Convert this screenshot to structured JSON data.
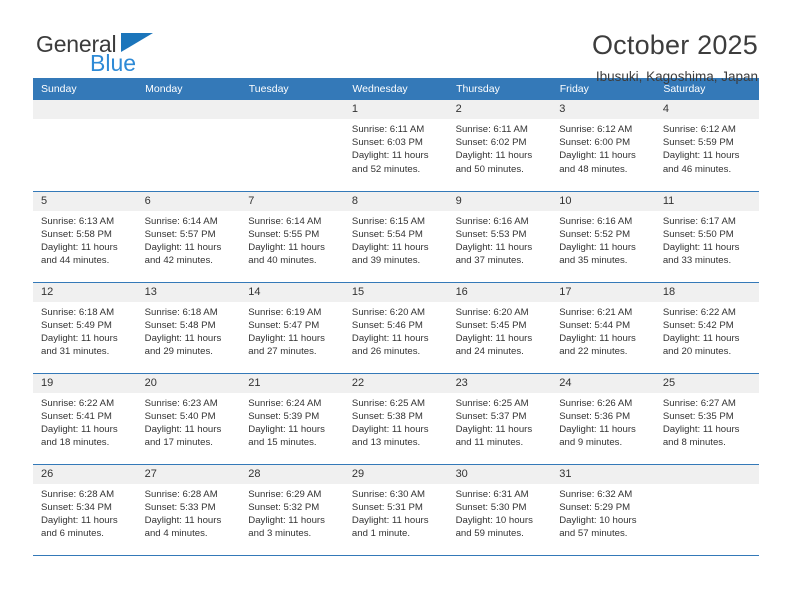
{
  "brand": {
    "name_top": "General",
    "name_bottom": "Blue",
    "triangle_color": "#1b75bb",
    "blue_text_color": "#2e8ad6"
  },
  "header": {
    "title": "October 2025",
    "subtitle": "Ibusuki, Kagoshima, Japan"
  },
  "colors": {
    "header_blue": "#3479b8",
    "daynum_band": "#f0f0f0",
    "text": "#333333"
  },
  "calendar": {
    "weekday_headers": [
      "Sunday",
      "Monday",
      "Tuesday",
      "Wednesday",
      "Thursday",
      "Friday",
      "Saturday"
    ],
    "weeks": [
      [
        {
          "day": "",
          "empty": true,
          "sunrise": "",
          "sunset": "",
          "daylight_line1": "",
          "daylight_line2": ""
        },
        {
          "day": "",
          "empty": true,
          "sunrise": "",
          "sunset": "",
          "daylight_line1": "",
          "daylight_line2": ""
        },
        {
          "day": "",
          "empty": true,
          "sunrise": "",
          "sunset": "",
          "daylight_line1": "",
          "daylight_line2": ""
        },
        {
          "day": "1",
          "empty": false,
          "sunrise": "Sunrise: 6:11 AM",
          "sunset": "Sunset: 6:03 PM",
          "daylight_line1": "Daylight: 11 hours",
          "daylight_line2": "and 52 minutes."
        },
        {
          "day": "2",
          "empty": false,
          "sunrise": "Sunrise: 6:11 AM",
          "sunset": "Sunset: 6:02 PM",
          "daylight_line1": "Daylight: 11 hours",
          "daylight_line2": "and 50 minutes."
        },
        {
          "day": "3",
          "empty": false,
          "sunrise": "Sunrise: 6:12 AM",
          "sunset": "Sunset: 6:00 PM",
          "daylight_line1": "Daylight: 11 hours",
          "daylight_line2": "and 48 minutes."
        },
        {
          "day": "4",
          "empty": false,
          "sunrise": "Sunrise: 6:12 AM",
          "sunset": "Sunset: 5:59 PM",
          "daylight_line1": "Daylight: 11 hours",
          "daylight_line2": "and 46 minutes."
        }
      ],
      [
        {
          "day": "5",
          "empty": false,
          "sunrise": "Sunrise: 6:13 AM",
          "sunset": "Sunset: 5:58 PM",
          "daylight_line1": "Daylight: 11 hours",
          "daylight_line2": "and 44 minutes."
        },
        {
          "day": "6",
          "empty": false,
          "sunrise": "Sunrise: 6:14 AM",
          "sunset": "Sunset: 5:57 PM",
          "daylight_line1": "Daylight: 11 hours",
          "daylight_line2": "and 42 minutes."
        },
        {
          "day": "7",
          "empty": false,
          "sunrise": "Sunrise: 6:14 AM",
          "sunset": "Sunset: 5:55 PM",
          "daylight_line1": "Daylight: 11 hours",
          "daylight_line2": "and 40 minutes."
        },
        {
          "day": "8",
          "empty": false,
          "sunrise": "Sunrise: 6:15 AM",
          "sunset": "Sunset: 5:54 PM",
          "daylight_line1": "Daylight: 11 hours",
          "daylight_line2": "and 39 minutes."
        },
        {
          "day": "9",
          "empty": false,
          "sunrise": "Sunrise: 6:16 AM",
          "sunset": "Sunset: 5:53 PM",
          "daylight_line1": "Daylight: 11 hours",
          "daylight_line2": "and 37 minutes."
        },
        {
          "day": "10",
          "empty": false,
          "sunrise": "Sunrise: 6:16 AM",
          "sunset": "Sunset: 5:52 PM",
          "daylight_line1": "Daylight: 11 hours",
          "daylight_line2": "and 35 minutes."
        },
        {
          "day": "11",
          "empty": false,
          "sunrise": "Sunrise: 6:17 AM",
          "sunset": "Sunset: 5:50 PM",
          "daylight_line1": "Daylight: 11 hours",
          "daylight_line2": "and 33 minutes."
        }
      ],
      [
        {
          "day": "12",
          "empty": false,
          "sunrise": "Sunrise: 6:18 AM",
          "sunset": "Sunset: 5:49 PM",
          "daylight_line1": "Daylight: 11 hours",
          "daylight_line2": "and 31 minutes."
        },
        {
          "day": "13",
          "empty": false,
          "sunrise": "Sunrise: 6:18 AM",
          "sunset": "Sunset: 5:48 PM",
          "daylight_line1": "Daylight: 11 hours",
          "daylight_line2": "and 29 minutes."
        },
        {
          "day": "14",
          "empty": false,
          "sunrise": "Sunrise: 6:19 AM",
          "sunset": "Sunset: 5:47 PM",
          "daylight_line1": "Daylight: 11 hours",
          "daylight_line2": "and 27 minutes."
        },
        {
          "day": "15",
          "empty": false,
          "sunrise": "Sunrise: 6:20 AM",
          "sunset": "Sunset: 5:46 PM",
          "daylight_line1": "Daylight: 11 hours",
          "daylight_line2": "and 26 minutes."
        },
        {
          "day": "16",
          "empty": false,
          "sunrise": "Sunrise: 6:20 AM",
          "sunset": "Sunset: 5:45 PM",
          "daylight_line1": "Daylight: 11 hours",
          "daylight_line2": "and 24 minutes."
        },
        {
          "day": "17",
          "empty": false,
          "sunrise": "Sunrise: 6:21 AM",
          "sunset": "Sunset: 5:44 PM",
          "daylight_line1": "Daylight: 11 hours",
          "daylight_line2": "and 22 minutes."
        },
        {
          "day": "18",
          "empty": false,
          "sunrise": "Sunrise: 6:22 AM",
          "sunset": "Sunset: 5:42 PM",
          "daylight_line1": "Daylight: 11 hours",
          "daylight_line2": "and 20 minutes."
        }
      ],
      [
        {
          "day": "19",
          "empty": false,
          "sunrise": "Sunrise: 6:22 AM",
          "sunset": "Sunset: 5:41 PM",
          "daylight_line1": "Daylight: 11 hours",
          "daylight_line2": "and 18 minutes."
        },
        {
          "day": "20",
          "empty": false,
          "sunrise": "Sunrise: 6:23 AM",
          "sunset": "Sunset: 5:40 PM",
          "daylight_line1": "Daylight: 11 hours",
          "daylight_line2": "and 17 minutes."
        },
        {
          "day": "21",
          "empty": false,
          "sunrise": "Sunrise: 6:24 AM",
          "sunset": "Sunset: 5:39 PM",
          "daylight_line1": "Daylight: 11 hours",
          "daylight_line2": "and 15 minutes."
        },
        {
          "day": "22",
          "empty": false,
          "sunrise": "Sunrise: 6:25 AM",
          "sunset": "Sunset: 5:38 PM",
          "daylight_line1": "Daylight: 11 hours",
          "daylight_line2": "and 13 minutes."
        },
        {
          "day": "23",
          "empty": false,
          "sunrise": "Sunrise: 6:25 AM",
          "sunset": "Sunset: 5:37 PM",
          "daylight_line1": "Daylight: 11 hours",
          "daylight_line2": "and 11 minutes."
        },
        {
          "day": "24",
          "empty": false,
          "sunrise": "Sunrise: 6:26 AM",
          "sunset": "Sunset: 5:36 PM",
          "daylight_line1": "Daylight: 11 hours",
          "daylight_line2": "and 9 minutes."
        },
        {
          "day": "25",
          "empty": false,
          "sunrise": "Sunrise: 6:27 AM",
          "sunset": "Sunset: 5:35 PM",
          "daylight_line1": "Daylight: 11 hours",
          "daylight_line2": "and 8 minutes."
        }
      ],
      [
        {
          "day": "26",
          "empty": false,
          "sunrise": "Sunrise: 6:28 AM",
          "sunset": "Sunset: 5:34 PM",
          "daylight_line1": "Daylight: 11 hours",
          "daylight_line2": "and 6 minutes."
        },
        {
          "day": "27",
          "empty": false,
          "sunrise": "Sunrise: 6:28 AM",
          "sunset": "Sunset: 5:33 PM",
          "daylight_line1": "Daylight: 11 hours",
          "daylight_line2": "and 4 minutes."
        },
        {
          "day": "28",
          "empty": false,
          "sunrise": "Sunrise: 6:29 AM",
          "sunset": "Sunset: 5:32 PM",
          "daylight_line1": "Daylight: 11 hours",
          "daylight_line2": "and 3 minutes."
        },
        {
          "day": "29",
          "empty": false,
          "sunrise": "Sunrise: 6:30 AM",
          "sunset": "Sunset: 5:31 PM",
          "daylight_line1": "Daylight: 11 hours",
          "daylight_line2": "and 1 minute."
        },
        {
          "day": "30",
          "empty": false,
          "sunrise": "Sunrise: 6:31 AM",
          "sunset": "Sunset: 5:30 PM",
          "daylight_line1": "Daylight: 10 hours",
          "daylight_line2": "and 59 minutes."
        },
        {
          "day": "31",
          "empty": false,
          "sunrise": "Sunrise: 6:32 AM",
          "sunset": "Sunset: 5:29 PM",
          "daylight_line1": "Daylight: 10 hours",
          "daylight_line2": "and 57 minutes."
        },
        {
          "day": "",
          "empty": true,
          "sunrise": "",
          "sunset": "",
          "daylight_line1": "",
          "daylight_line2": ""
        }
      ]
    ]
  }
}
